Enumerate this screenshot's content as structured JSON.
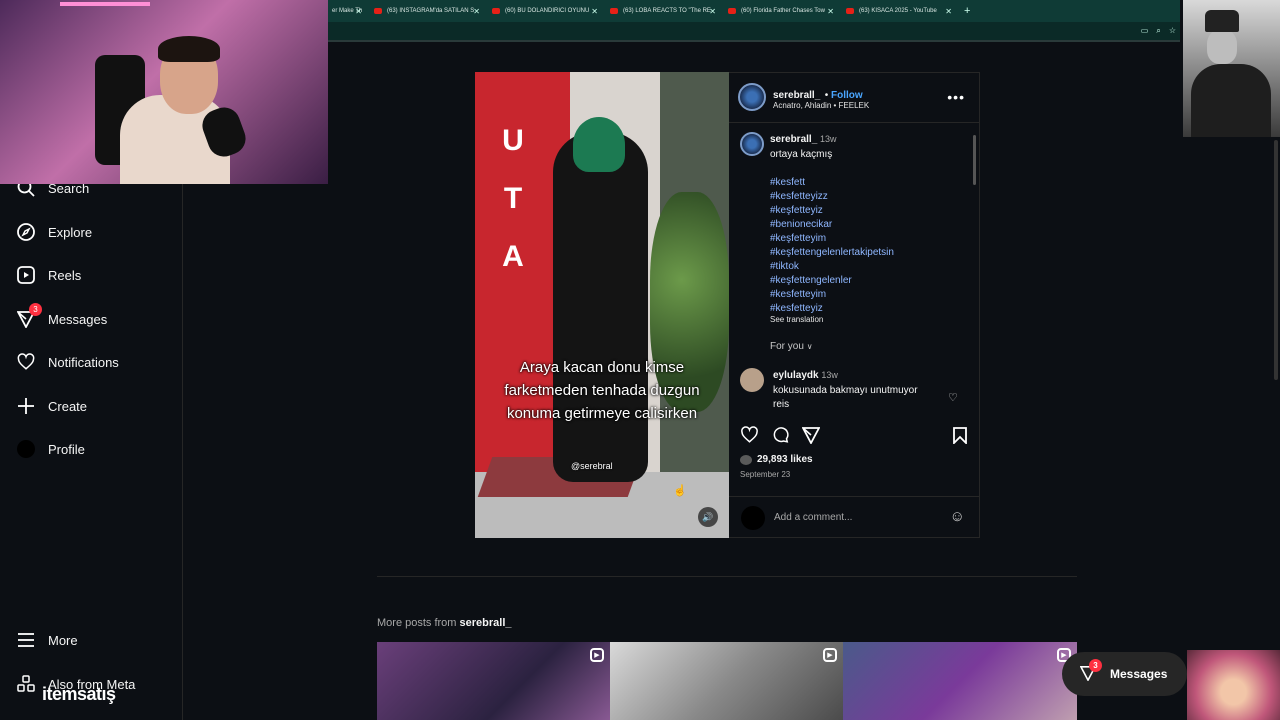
{
  "tabs": [
    {
      "label": "er Make Th"
    },
    {
      "label": "(63) INSTAGRAM'da SATILAN S"
    },
    {
      "label": "(60) BU DOLANDIRICI OYUNU"
    },
    {
      "label": "(63) LOBA REACTS TO \"The RE"
    },
    {
      "label": "(60) Florida Father Chases Tow"
    },
    {
      "label": "(63) KISACA 2025 - YouTube"
    }
  ],
  "new_tab": "+",
  "sidebar": {
    "items": [
      {
        "label": "Search"
      },
      {
        "label": "Explore"
      },
      {
        "label": "Reels"
      },
      {
        "label": "Messages",
        "badge": "3"
      },
      {
        "label": "Notifications"
      },
      {
        "label": "Create"
      },
      {
        "label": "Profile"
      }
    ],
    "more": "More",
    "also_from_meta": "Also from Meta",
    "watermark_logo": "itemsatış"
  },
  "post": {
    "video_caption": [
      "Araya kacan donu kimse",
      "farketmeden tenhada duzgun",
      "konuma getirmeye calisirken"
    ],
    "video_watermark": "@serebral",
    "video_letters": [
      "U",
      "T",
      "A"
    ],
    "username": "serebrall_",
    "follow": "Follow",
    "location": "Acnatro, Ahladin • FEELEK",
    "caption_time": "13w",
    "caption": "ortaya kaçmış",
    "hashtags": [
      "#kesfett",
      "#kesfetteyizz",
      "#keşfetteyiz",
      "#benionecikar",
      "#keşfetteyim",
      "#keşfettengelenlertakipetsin",
      "#tiktok",
      "#keşfettengelenler",
      "#kesfetteyim",
      "#kesfetteyiz"
    ],
    "see_translation": "See translation",
    "for_you": "For you",
    "comment": {
      "user": "eylulaydk",
      "time": "13w",
      "text_line1": "kokusunada bakmayı unutmuyor",
      "text_line2": "reis"
    },
    "likes": "29,893 likes",
    "date": "September 23",
    "add_comment_placeholder": "Add a comment..."
  },
  "more_posts": {
    "prefix": "More posts from ",
    "user": "serebrall_"
  },
  "floating_messages": {
    "label": "Messages",
    "badge": "3"
  },
  "colors": {
    "background": "#0c0f14",
    "accent_link": "#4aa6ff",
    "hashtag": "#8fb7ff",
    "badge": "#ff3040",
    "tabbar": "#0f3b36"
  },
  "icons": [
    "search-icon",
    "compass-icon",
    "reels-icon",
    "messenger-icon",
    "heart-icon",
    "plus-icon",
    "hamburger-icon",
    "meta-icon",
    "comment-icon",
    "share-icon",
    "bookmark-icon",
    "emoji-icon",
    "volume-icon"
  ]
}
